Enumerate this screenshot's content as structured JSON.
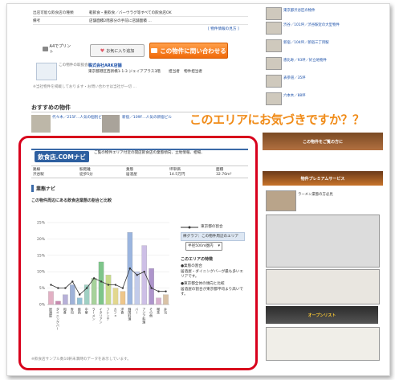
{
  "top_table": {
    "rows": [
      {
        "label": "出店可能な飲食店の種類",
        "value": "軽飲食・重飲食／バーウラグ等すべての飲食店OK"
      },
      {
        "label": "備考",
        "value": "店舗面積2階部分の手前に店舗面積 …"
      },
      {
        "label": "",
        "value": "[ 物件情報の見方 ]"
      }
    ]
  },
  "actions": {
    "print_label": "A4でプリント",
    "favorite_label": "お気に入り追加",
    "inquiry_label": "この物件に問い合わせる",
    "inquiry_icon": "envelope-icon"
  },
  "company": {
    "caption": "この物件の取扱会社",
    "name": "株式会社ARK店舗",
    "address": "東京都港区西新橋1-1-3 ジェイアプラス3階",
    "agent_label": "担当者",
    "agent_name": "物件担当者"
  },
  "note": "※当社物件を掲載しております・お問い合わせは当社が一切 …",
  "recommend": {
    "title": "おすすめの物件",
    "items": [
      {
        "text": "代々木／215F…人気の個別ビル"
      },
      {
        "text": "新宿／109F…人気の新宿ビル"
      }
    ]
  },
  "annotation": "このエリアにお気づきですか？？",
  "navi": {
    "logo": "飲食店.COMナビ",
    "description": "ご覧の物件エリア付近の開店飲食店の業態傾向、立地情報、相場、",
    "stats": [
      {
        "label": "路線",
        "value": "渋谷駅"
      },
      {
        "label": "駅距離",
        "value": "徒歩5分"
      },
      {
        "label": "業態",
        "value": "居酒屋"
      },
      {
        "label": "坪単価",
        "value": "14.5万円"
      },
      {
        "label": "面積",
        "value": "32.70m²"
      }
    ]
  },
  "panel": {
    "title": "業態ナビ",
    "subtitle": "この物件周辺にある飲食店業態の割合と比較",
    "legend_line": "東京都の割合",
    "legend_bar": "棒グラフ：この物件周辺のエリア",
    "select_value": "半径500m圏内",
    "footnote": "※飲食店サンプル数10軒未満時のデータを表示しています。",
    "features_title": "このエリアの特徴",
    "features": [
      "●業態の割合",
      "居酒屋・ダイニングバーが最も多いエリアです。",
      "●東京都全体の傾向と比較",
      "居酒屋の割合が東京都平均より高いです。"
    ]
  },
  "chart_data": {
    "type": "bar",
    "categories": [
      "居酒屋",
      "ダイニングバー",
      "和食",
      "寿司",
      "焼肉",
      "中華",
      "ラーメン",
      "イタリアン",
      "フレンチ",
      "カフェ",
      "洋食",
      "韓国料理",
      "バー",
      "アジア料理",
      "その他",
      "喫茶",
      "弁当"
    ],
    "series": [
      {
        "name": "この物件周辺のエリア",
        "values": [
          4,
          1,
          3,
          6,
          2,
          6,
          8,
          13,
          9,
          5,
          4,
          22,
          10,
          18,
          11,
          2,
          3
        ]
      },
      {
        "name": "東京都の割合",
        "values": [
          6,
          5,
          5,
          7,
          3,
          5,
          8,
          7,
          6,
          6,
          5,
          11,
          9,
          10,
          5,
          4,
          4
        ]
      }
    ],
    "bar_colors": [
      "#e2b0c4",
      "#c98ab0",
      "#b7b0d8",
      "#9fb2d8",
      "#93c2d6",
      "#9fd0c3",
      "#a7d29b",
      "#7ec58a",
      "#c6d989",
      "#e2d78e",
      "#eec68a",
      "#9bb5df",
      "#c2cbea",
      "#cdbfe6",
      "#ae95cc",
      "#d8b1cf",
      "#d9c2a6"
    ],
    "ylim": [
      0,
      25
    ],
    "yticks": [
      "0%",
      "5%",
      "10%",
      "15%",
      "20%",
      "25%"
    ],
    "grid": true
  },
  "right_col": {
    "links": [
      "東京都渋谷区の物件",
      "渋谷／101坪／渋谷駅近の大型物件",
      "新宿／104坪／新宿三丁目駅",
      "恵比寿／93坪／好立地物件",
      "表参道／35坪",
      "六本木／88坪"
    ],
    "banner1": "この物件をご覧の方に",
    "banner2": "物件プレミアムサービス",
    "promo": "ラーメン業態の方必見",
    "promo2": "オープンリスト"
  }
}
